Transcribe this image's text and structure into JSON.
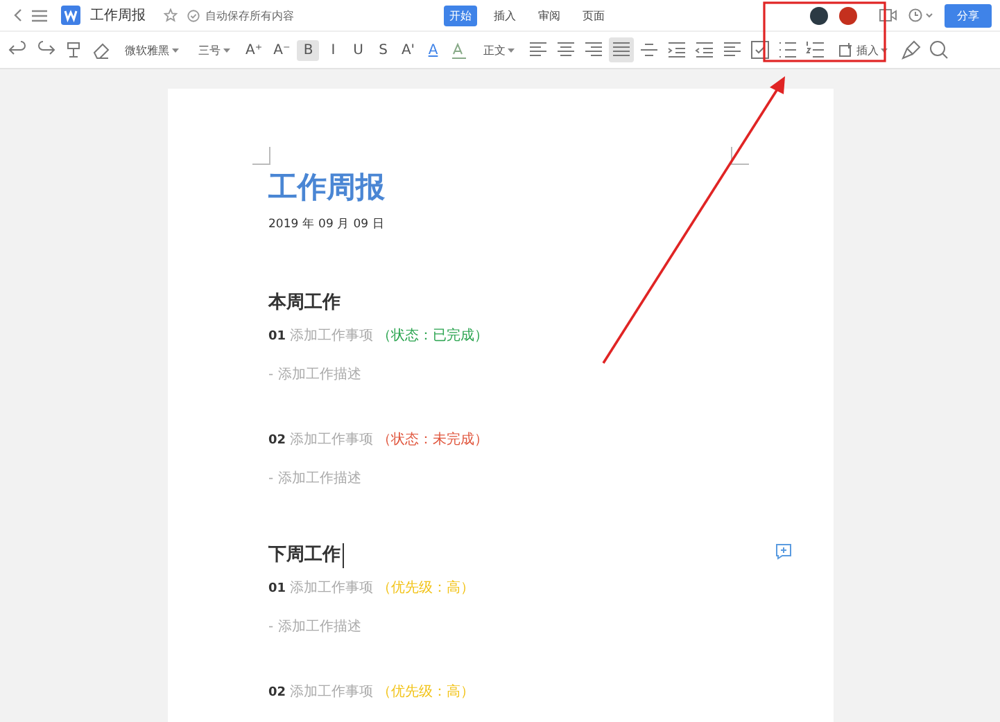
{
  "window": {
    "title": "工作周报",
    "save_status": "自动保存所有内容"
  },
  "tabs": [
    {
      "label": "开始",
      "selected": true
    },
    {
      "label": "插入",
      "selected": false
    },
    {
      "label": "审阅",
      "selected": false
    },
    {
      "label": "页面",
      "selected": false
    }
  ],
  "share_button": "分享",
  "toolbar": [
    {
      "kind": "undo",
      "selected": false
    },
    {
      "kind": "redo",
      "selected": false
    },
    {
      "kind": "painter",
      "selected": false
    },
    {
      "kind": "eraser",
      "selected": false
    },
    {
      "kind": "dropdown",
      "label": "微软雅黑",
      "selected": false
    },
    {
      "kind": "dropdown",
      "label": "三号",
      "selected": false
    },
    {
      "kind": "glyph",
      "label": "A⁺",
      "selected": false
    },
    {
      "kind": "glyph",
      "label": "A⁻",
      "selected": false
    },
    {
      "kind": "glyph",
      "label": "B",
      "selected": true
    },
    {
      "kind": "glyph",
      "label": "I",
      "selected": false
    },
    {
      "kind": "glyph",
      "label": "U",
      "selected": false
    },
    {
      "kind": "glyph",
      "label": "S",
      "selected": false
    },
    {
      "kind": "glyph",
      "label": "A'",
      "selected": false
    },
    {
      "kind": "color",
      "label": "A",
      "selected": false
    },
    {
      "kind": "highlight",
      "selected": false
    },
    {
      "kind": "dropdown",
      "label": "正文",
      "selected": false
    },
    {
      "kind": "align-left",
      "selected": false
    },
    {
      "kind": "align-center",
      "selected": false
    },
    {
      "kind": "align-right",
      "selected": false
    },
    {
      "kind": "align-justify",
      "selected": true
    },
    {
      "kind": "spacing",
      "selected": false
    },
    {
      "kind": "indent",
      "selected": false
    },
    {
      "kind": "outdent",
      "selected": false
    },
    {
      "kind": "align-left",
      "selected": false
    },
    {
      "kind": "checklist",
      "selected": false
    },
    {
      "kind": "bullets",
      "selected": false
    },
    {
      "kind": "numbering",
      "selected": false
    },
    {
      "kind": "insert",
      "label": "插入",
      "selected": false
    },
    {
      "kind": "brush",
      "selected": false
    },
    {
      "kind": "search",
      "selected": false
    }
  ],
  "document": {
    "title": "工作周报",
    "date": "2019 年 09 月 09 日",
    "sections": [
      {
        "heading": "本周工作",
        "cursor": false,
        "items": [
          {
            "number": "01",
            "task": "添加工作事项",
            "status": "（状态：已完成）",
            "color": "#2aa44f",
            "description": "- 添加工作描述"
          },
          {
            "number": "02",
            "task": "添加工作事项",
            "status": "（状态：未完成）",
            "color": "#e0553c",
            "description": "- 添加工作描述"
          }
        ]
      },
      {
        "heading": "下周工作",
        "cursor": true,
        "items": [
          {
            "number": "01",
            "task": "添加工作事项",
            "status": "（优先级：高）",
            "color": "#f2c318",
            "description": "- 添加工作描述"
          },
          {
            "number": "02",
            "task": "添加工作事项",
            "status": "（优先级：高）",
            "color": "#f2c318"
          }
        ]
      }
    ]
  }
}
